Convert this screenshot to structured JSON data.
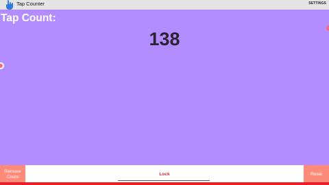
{
  "app": {
    "title": "Tap Counter",
    "icon": "hand-tap-icon",
    "settings_label": "SETTINGS"
  },
  "counter": {
    "label": "Tap Count:",
    "value": "138"
  },
  "bottom": {
    "remove_label": "Remove Count",
    "lock_label": "Lock",
    "reset_label": "Reset"
  },
  "colors": {
    "background": "#b38cff",
    "accent_button": "#ff8a7a",
    "lock_text": "#cc2233",
    "bottom_strip": "#e8202a"
  }
}
